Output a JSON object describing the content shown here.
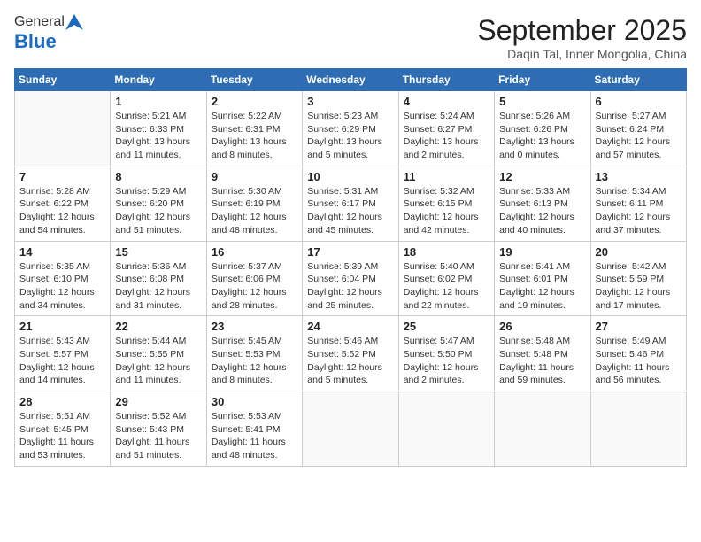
{
  "logo": {
    "general": "General",
    "blue": "Blue"
  },
  "header": {
    "month": "September 2025",
    "location": "Daqin Tal, Inner Mongolia, China"
  },
  "weekdays": [
    "Sunday",
    "Monday",
    "Tuesday",
    "Wednesday",
    "Thursday",
    "Friday",
    "Saturday"
  ],
  "weeks": [
    [
      {
        "day": "",
        "info": ""
      },
      {
        "day": "1",
        "info": "Sunrise: 5:21 AM\nSunset: 6:33 PM\nDaylight: 13 hours\nand 11 minutes."
      },
      {
        "day": "2",
        "info": "Sunrise: 5:22 AM\nSunset: 6:31 PM\nDaylight: 13 hours\nand 8 minutes."
      },
      {
        "day": "3",
        "info": "Sunrise: 5:23 AM\nSunset: 6:29 PM\nDaylight: 13 hours\nand 5 minutes."
      },
      {
        "day": "4",
        "info": "Sunrise: 5:24 AM\nSunset: 6:27 PM\nDaylight: 13 hours\nand 2 minutes."
      },
      {
        "day": "5",
        "info": "Sunrise: 5:26 AM\nSunset: 6:26 PM\nDaylight: 13 hours\nand 0 minutes."
      },
      {
        "day": "6",
        "info": "Sunrise: 5:27 AM\nSunset: 6:24 PM\nDaylight: 12 hours\nand 57 minutes."
      }
    ],
    [
      {
        "day": "7",
        "info": "Sunrise: 5:28 AM\nSunset: 6:22 PM\nDaylight: 12 hours\nand 54 minutes."
      },
      {
        "day": "8",
        "info": "Sunrise: 5:29 AM\nSunset: 6:20 PM\nDaylight: 12 hours\nand 51 minutes."
      },
      {
        "day": "9",
        "info": "Sunrise: 5:30 AM\nSunset: 6:19 PM\nDaylight: 12 hours\nand 48 minutes."
      },
      {
        "day": "10",
        "info": "Sunrise: 5:31 AM\nSunset: 6:17 PM\nDaylight: 12 hours\nand 45 minutes."
      },
      {
        "day": "11",
        "info": "Sunrise: 5:32 AM\nSunset: 6:15 PM\nDaylight: 12 hours\nand 42 minutes."
      },
      {
        "day": "12",
        "info": "Sunrise: 5:33 AM\nSunset: 6:13 PM\nDaylight: 12 hours\nand 40 minutes."
      },
      {
        "day": "13",
        "info": "Sunrise: 5:34 AM\nSunset: 6:11 PM\nDaylight: 12 hours\nand 37 minutes."
      }
    ],
    [
      {
        "day": "14",
        "info": "Sunrise: 5:35 AM\nSunset: 6:10 PM\nDaylight: 12 hours\nand 34 minutes."
      },
      {
        "day": "15",
        "info": "Sunrise: 5:36 AM\nSunset: 6:08 PM\nDaylight: 12 hours\nand 31 minutes."
      },
      {
        "day": "16",
        "info": "Sunrise: 5:37 AM\nSunset: 6:06 PM\nDaylight: 12 hours\nand 28 minutes."
      },
      {
        "day": "17",
        "info": "Sunrise: 5:39 AM\nSunset: 6:04 PM\nDaylight: 12 hours\nand 25 minutes."
      },
      {
        "day": "18",
        "info": "Sunrise: 5:40 AM\nSunset: 6:02 PM\nDaylight: 12 hours\nand 22 minutes."
      },
      {
        "day": "19",
        "info": "Sunrise: 5:41 AM\nSunset: 6:01 PM\nDaylight: 12 hours\nand 19 minutes."
      },
      {
        "day": "20",
        "info": "Sunrise: 5:42 AM\nSunset: 5:59 PM\nDaylight: 12 hours\nand 17 minutes."
      }
    ],
    [
      {
        "day": "21",
        "info": "Sunrise: 5:43 AM\nSunset: 5:57 PM\nDaylight: 12 hours\nand 14 minutes."
      },
      {
        "day": "22",
        "info": "Sunrise: 5:44 AM\nSunset: 5:55 PM\nDaylight: 12 hours\nand 11 minutes."
      },
      {
        "day": "23",
        "info": "Sunrise: 5:45 AM\nSunset: 5:53 PM\nDaylight: 12 hours\nand 8 minutes."
      },
      {
        "day": "24",
        "info": "Sunrise: 5:46 AM\nSunset: 5:52 PM\nDaylight: 12 hours\nand 5 minutes."
      },
      {
        "day": "25",
        "info": "Sunrise: 5:47 AM\nSunset: 5:50 PM\nDaylight: 12 hours\nand 2 minutes."
      },
      {
        "day": "26",
        "info": "Sunrise: 5:48 AM\nSunset: 5:48 PM\nDaylight: 11 hours\nand 59 minutes."
      },
      {
        "day": "27",
        "info": "Sunrise: 5:49 AM\nSunset: 5:46 PM\nDaylight: 11 hours\nand 56 minutes."
      }
    ],
    [
      {
        "day": "28",
        "info": "Sunrise: 5:51 AM\nSunset: 5:45 PM\nDaylight: 11 hours\nand 53 minutes."
      },
      {
        "day": "29",
        "info": "Sunrise: 5:52 AM\nSunset: 5:43 PM\nDaylight: 11 hours\nand 51 minutes."
      },
      {
        "day": "30",
        "info": "Sunrise: 5:53 AM\nSunset: 5:41 PM\nDaylight: 11 hours\nand 48 minutes."
      },
      {
        "day": "",
        "info": ""
      },
      {
        "day": "",
        "info": ""
      },
      {
        "day": "",
        "info": ""
      },
      {
        "day": "",
        "info": ""
      }
    ]
  ]
}
